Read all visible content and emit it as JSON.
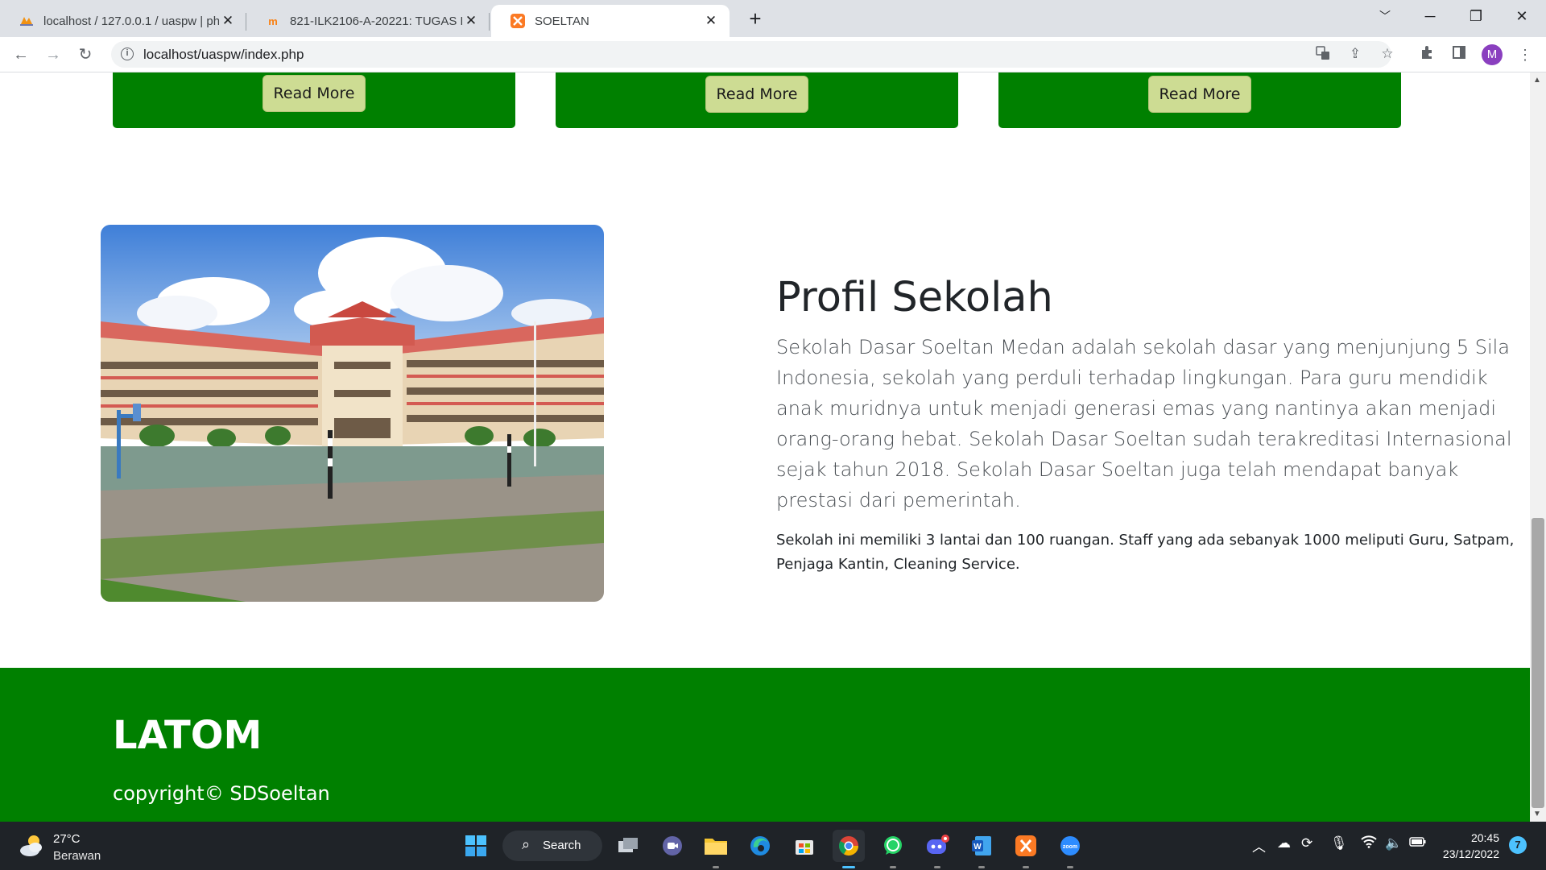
{
  "browser": {
    "tabs": [
      {
        "title": "localhost / 127.0.0.1 / uaspw | ph",
        "icon": "phpmyadmin-icon"
      },
      {
        "title": "821-ILK2106-A-20221: TUGAS PE",
        "icon": "moodle-icon"
      },
      {
        "title": "SOELTAN",
        "icon": "xampp-icon",
        "active": true
      }
    ],
    "url": "localhost/uaspw/index.php",
    "profile_initial": "M"
  },
  "page": {
    "cards": [
      {
        "button": "Read More"
      },
      {
        "button": "Read More"
      },
      {
        "button": "Read More"
      }
    ],
    "about": {
      "title": "Profil Sekolah",
      "lead": "Sekolah Dasar Soeltan Medan adalah sekolah dasar yang menjunjung 5 Sila Indonesia, sekolah yang perduli terhadap lingkungan. Para guru mendidik anak muridnya untuk menjadi generasi emas yang nantinya akan menjadi orang-orang hebat. Sekolah Dasar Soeltan sudah terakreditasi Internasional sejak tahun 2018. Sekolah Dasar Soeltan juga telah mendapat banyak prestasi dari pemerintah.",
      "text": "Sekolah ini memiliki 3 lantai dan 100 ruangan. Staff yang ada sebanyak 1000 meliputi Guru, Satpam, Penjaga Kantin, Cleaning Service."
    },
    "footer": {
      "brand": "LATOM",
      "copyright": "copyright© SDSoeltan"
    },
    "colors": {
      "primary_green": "#008000",
      "button_bg": "#cddc93"
    }
  },
  "taskbar": {
    "weather": {
      "temp": "27°C",
      "condition": "Berawan"
    },
    "search_label": "Search",
    "clock": {
      "time": "20:45",
      "date": "23/12/2022"
    },
    "notifications": "7"
  }
}
